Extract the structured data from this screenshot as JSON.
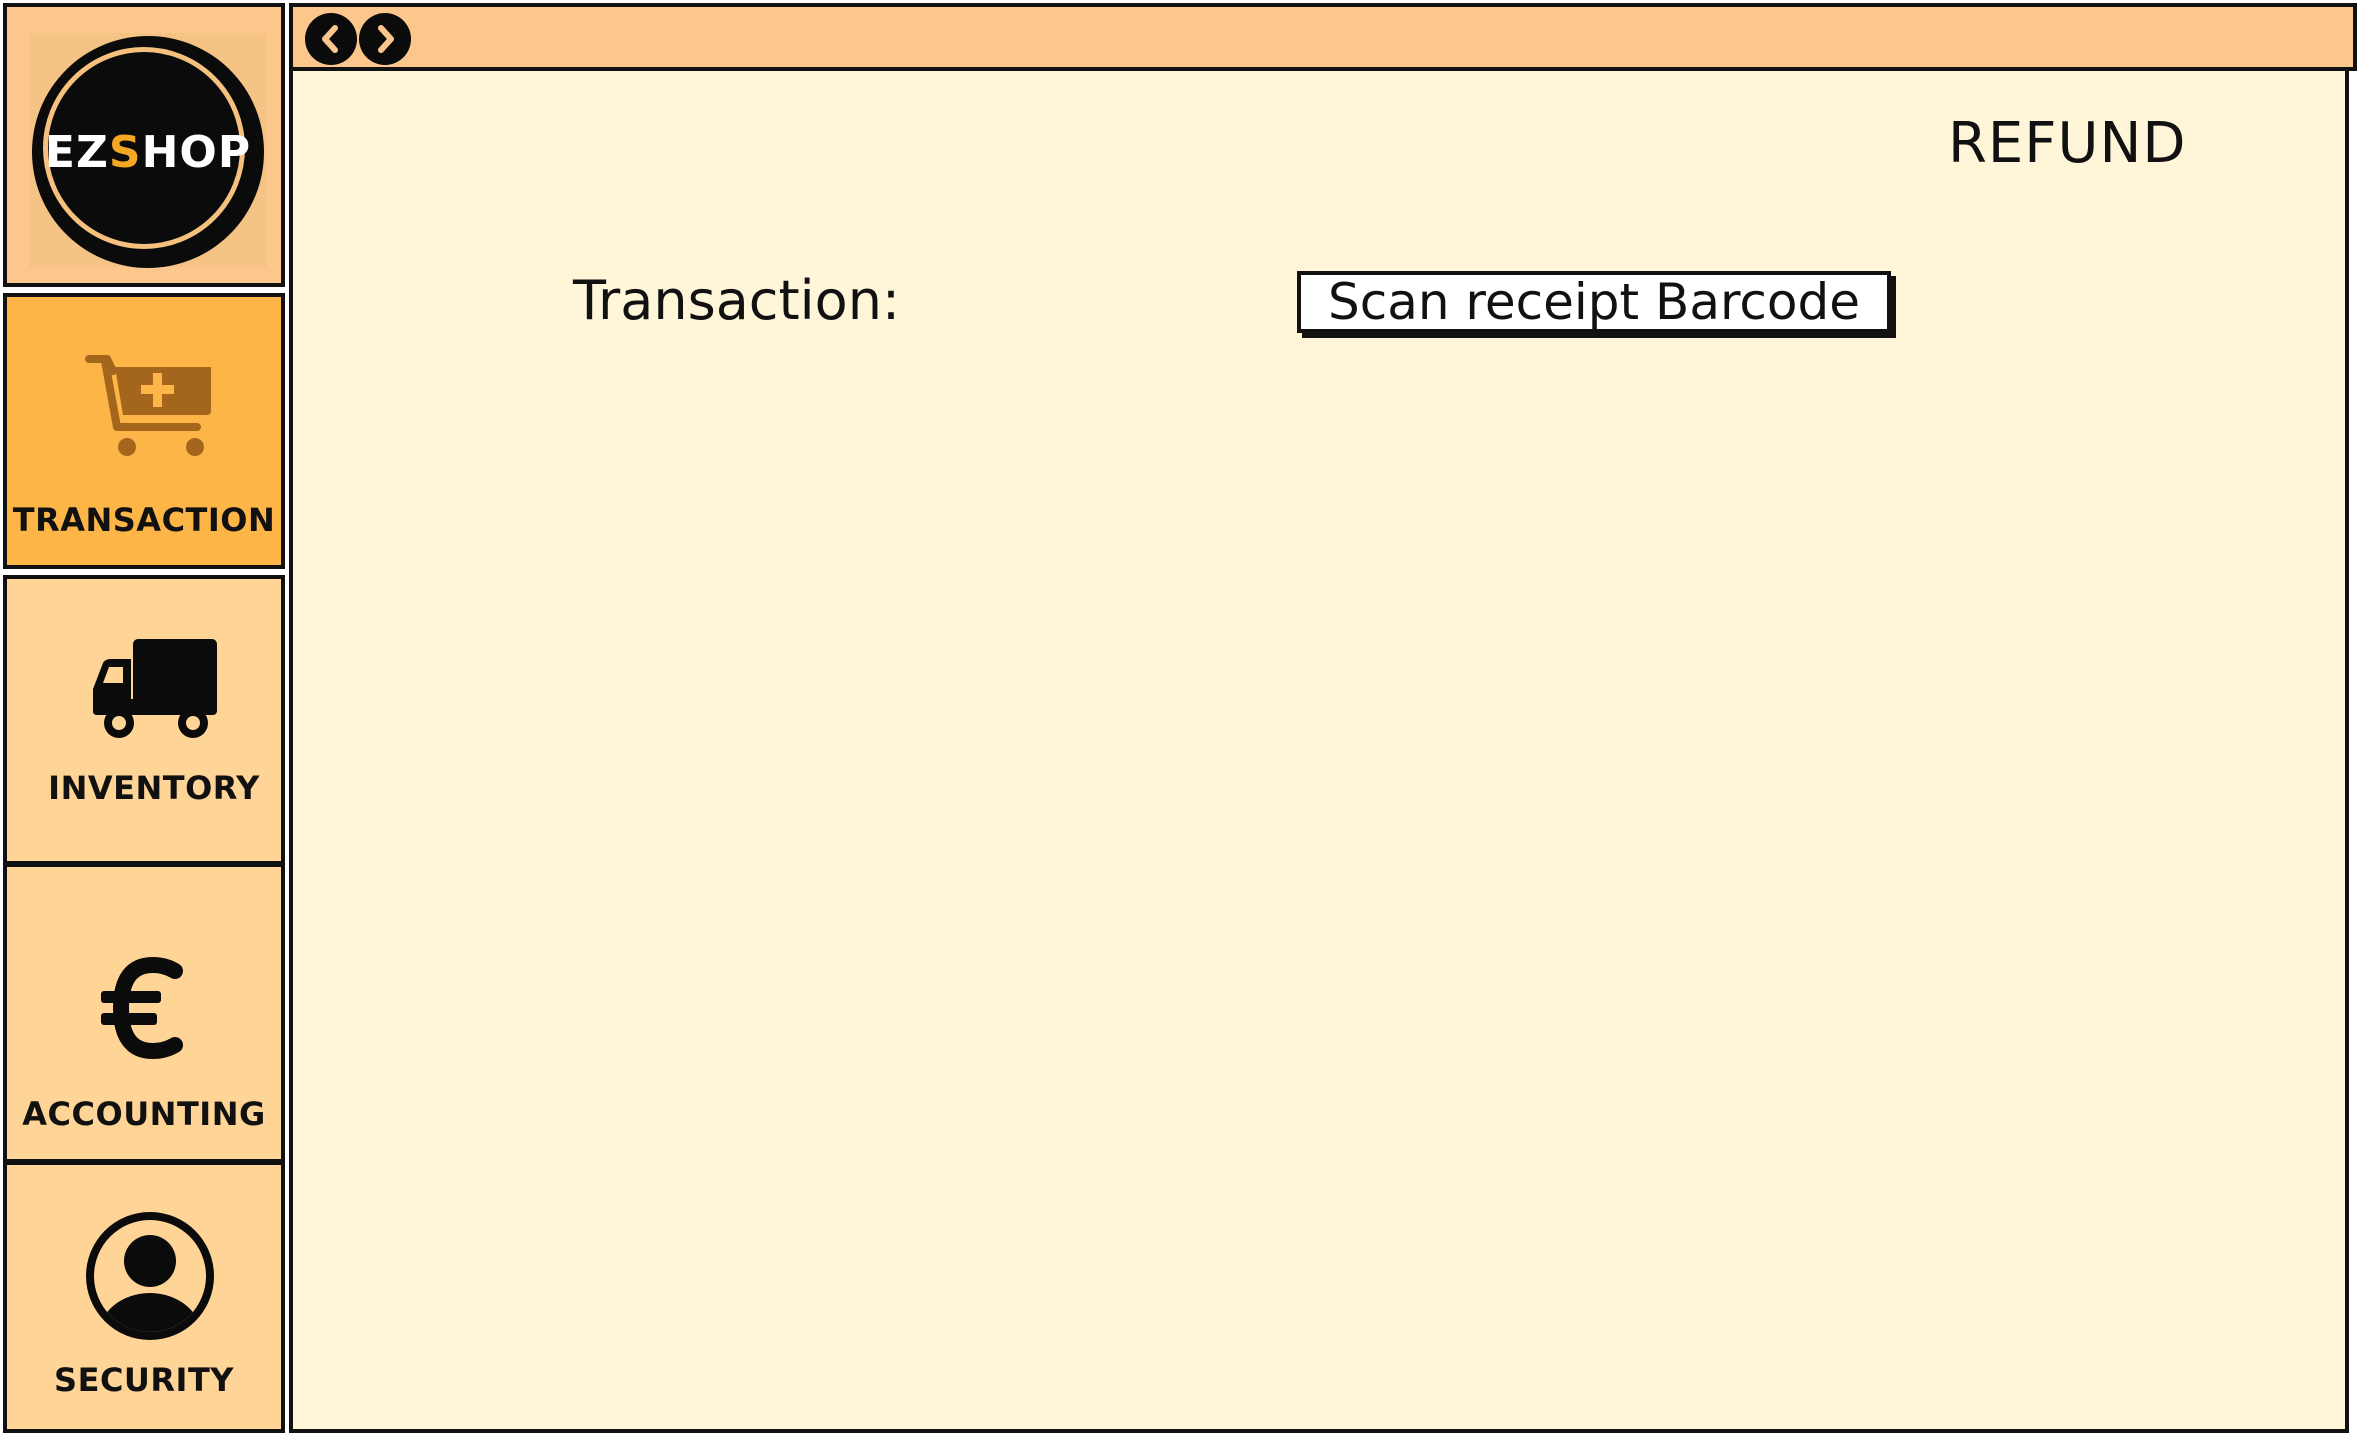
{
  "app": {
    "logo": {
      "text_part1": "EZ",
      "text_accent": "S",
      "text_part2": "HOP"
    }
  },
  "sidebar": {
    "items": [
      {
        "id": "transaction",
        "label": "TRANSACTION",
        "icon": "cart-add-icon",
        "active": true
      },
      {
        "id": "inventory",
        "label": "INVENTORY",
        "icon": "truck-icon",
        "active": false
      },
      {
        "id": "accounting",
        "label": "ACCOUNTING",
        "icon": "euro-icon",
        "active": false
      },
      {
        "id": "security",
        "label": "SECURITY",
        "icon": "user-icon",
        "active": false
      }
    ]
  },
  "toolbar": {
    "back_icon": "chevron-left-icon",
    "forward_icon": "chevron-right-icon"
  },
  "main": {
    "title": "REFUND",
    "transaction_label": "Transaction:",
    "scan_button_label": "Scan receipt Barcode"
  },
  "colors": {
    "titlebar": "#fbc78c",
    "sidebar_item": "#ffd497",
    "sidebar_active": "#fdb548",
    "content_bg": "#fff5d9",
    "logo_accent": "#f5a623"
  }
}
